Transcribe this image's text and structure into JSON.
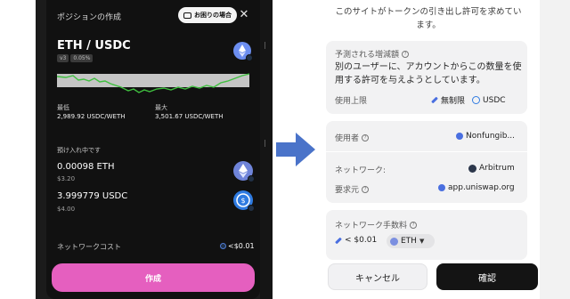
{
  "left": {
    "header_title": "ポジションの作成",
    "help_label": "お困りの場合",
    "close_glyph": "✕",
    "pair": "ETH / USDC",
    "version_badge": "v3",
    "fee_badge": "0.05%",
    "min_label": "最低",
    "min_value": "2,989.92 USDC/WETH",
    "max_label": "最大",
    "max_value": "3,501.67 USDC/WETH",
    "deposit_label": "預け入れ中です",
    "token1_amount": "0.00098 ETH",
    "token1_usd": "$3.20",
    "token2_amount": "3.999779 USDC",
    "token2_usd": "$4.00",
    "network_cost_label": "ネットワークコスト",
    "network_cost_value": "<$0.01",
    "create_button": "作成",
    "create_color": "#e55fbf",
    "icons": [
      "chat-icon",
      "close-icon",
      "eth-logo-icon",
      "usdc-logo-icon",
      "arbitrum-badge-icon"
    ]
  },
  "right": {
    "top_message": "このサイトがトークンの引き出し許可を求めています。",
    "predicted_title": "予測される増減額",
    "predicted_text": "別のユーザーに、アカウントからこの数量を使用する許可を与えようとしています。",
    "limit_label": "使用上限",
    "limit_value": "無制限",
    "limit_token": "USDC",
    "user_label": "使用者",
    "user_value": "Nonfungib...",
    "network_label": "ネットワーク:",
    "network_value": "Arbitrum",
    "requester_label": "要求元",
    "requester_value": "app.uniswap.org",
    "fee_title": "ネットワーク手数料",
    "fee_value": "< $0.01",
    "fee_token": "ETH",
    "cancel_button": "キャンセル",
    "confirm_button": "確認",
    "accent_color": "#4a6fe0"
  }
}
